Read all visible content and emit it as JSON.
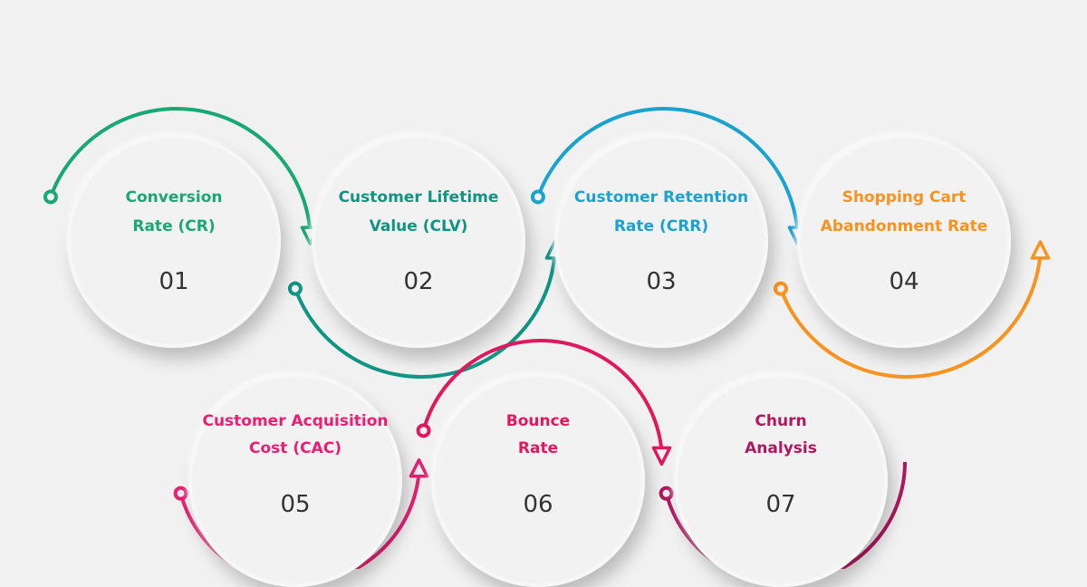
{
  "diagram": {
    "type": "process-flow",
    "steps": [
      {
        "number": "01",
        "line1": "Conversion",
        "line2": "Rate (CR)",
        "color": "#18a874"
      },
      {
        "number": "02",
        "line1": "Customer Lifetime",
        "line2": "Value (CLV)",
        "color": "#0f9582"
      },
      {
        "number": "03",
        "line1": "Customer Retention",
        "line2": "Rate (CRR)",
        "color": "#1aa3cf"
      },
      {
        "number": "04",
        "line1": "Shopping Cart",
        "line2": "Abandonment Rate",
        "color": "#f7931e"
      },
      {
        "number": "05",
        "line1": "Customer Acquisition",
        "line2": "Cost (CAC)",
        "color": "#e81f72"
      },
      {
        "number": "06",
        "line1": "Bounce",
        "line2": "Rate",
        "color": "#e0195f"
      },
      {
        "number": "07",
        "line1": "Churn",
        "line2": "Analysis",
        "color": "#b0185e"
      }
    ]
  }
}
